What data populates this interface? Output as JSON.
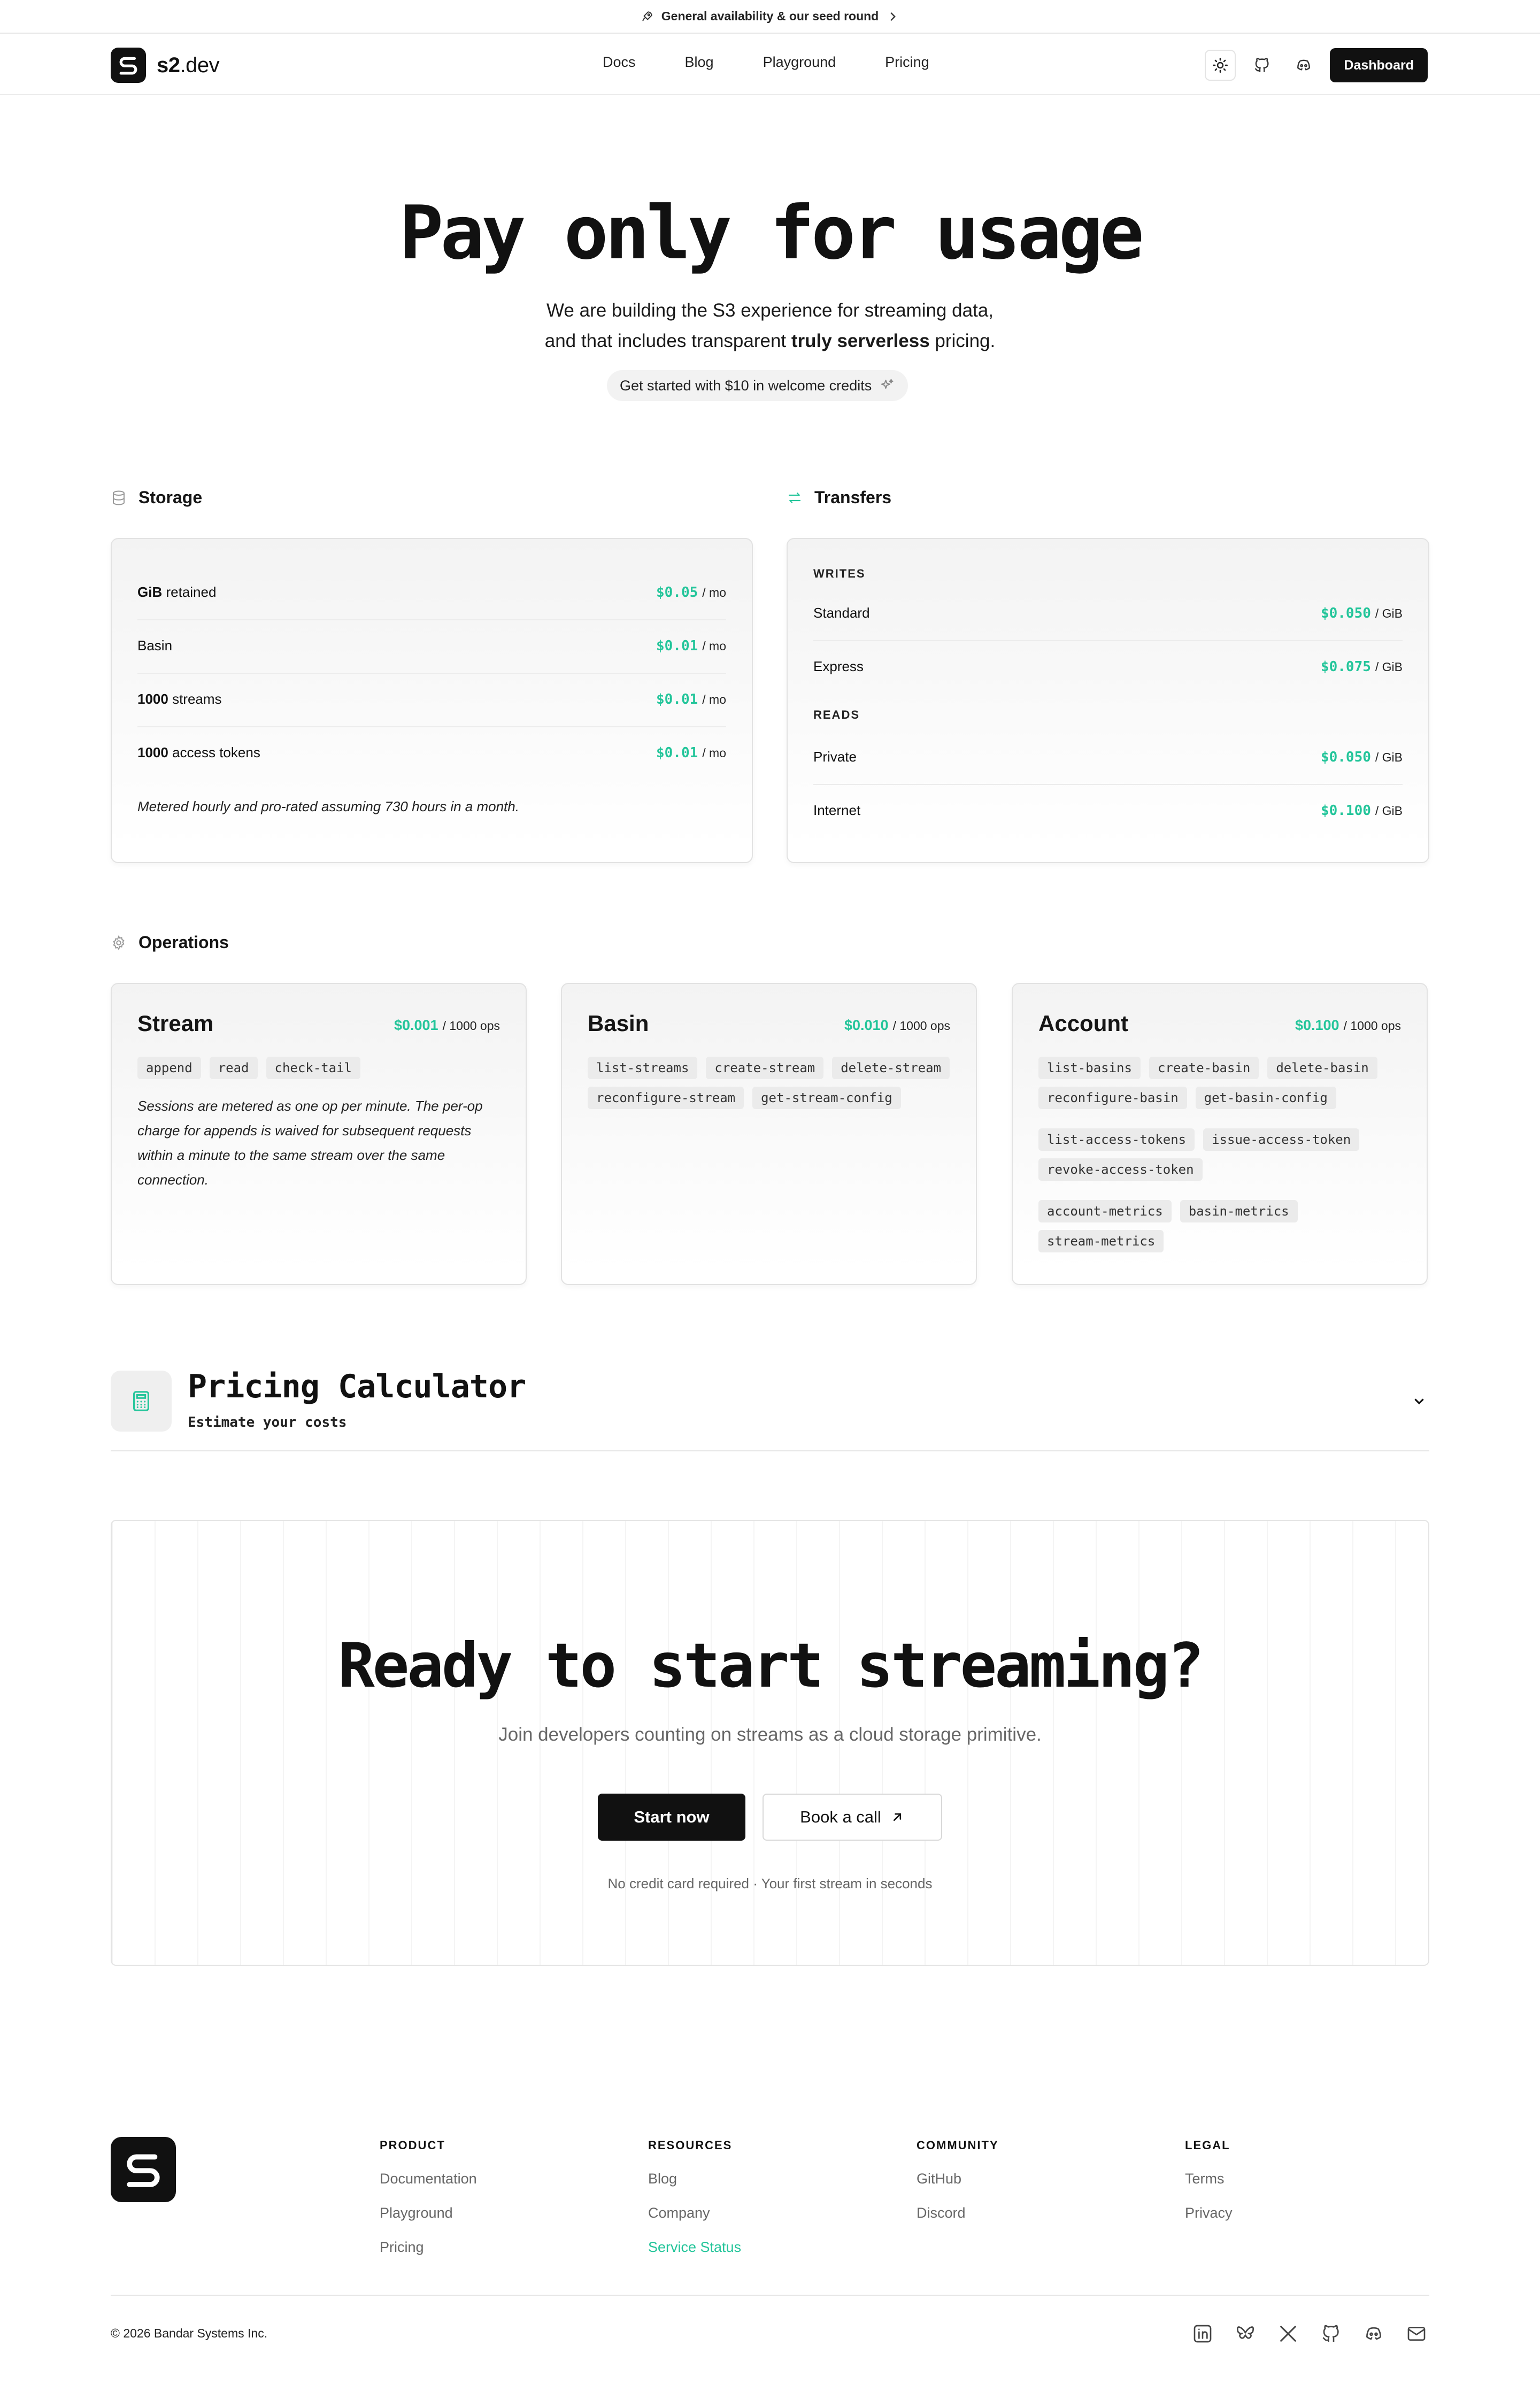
{
  "announcement": {
    "text": "General availability & our seed round"
  },
  "nav": {
    "brand_bold": "s2",
    "brand_rest": ".dev",
    "links": [
      "Docs",
      "Blog",
      "Playground",
      "Pricing"
    ],
    "dashboard_label": "Dashboard"
  },
  "hero": {
    "title": "Pay only for usage",
    "line1": "We are building the S3 experience for streaming data,",
    "line2_pre": "and that includes transparent ",
    "line2_bold": "truly serverless",
    "line2_post": " pricing.",
    "credit_pill": "Get started with $10 in welcome credits"
  },
  "storage": {
    "heading": "Storage",
    "rows": [
      {
        "bold": "GiB",
        "rest": " retained",
        "price": "$0.05",
        "unit": "/ mo"
      },
      {
        "bold": "",
        "rest": "Basin",
        "price": "$0.01",
        "unit": "/ mo"
      },
      {
        "bold": "1000",
        "rest": " streams",
        "price": "$0.01",
        "unit": "/ mo"
      },
      {
        "bold": "1000",
        "rest": " access tokens",
        "price": "$0.01",
        "unit": "/ mo"
      }
    ],
    "note": "Metered hourly and pro-rated assuming 730 hours in a month."
  },
  "transfers": {
    "heading": "Transfers",
    "writes_label": "WRITES",
    "reads_label": "READS",
    "writes": [
      {
        "label": "Standard",
        "price": "$0.050",
        "unit": "/ GiB"
      },
      {
        "label": "Express",
        "price": "$0.075",
        "unit": "/ GiB"
      }
    ],
    "reads": [
      {
        "label": "Private",
        "price": "$0.050",
        "unit": "/ GiB"
      },
      {
        "label": "Internet",
        "price": "$0.100",
        "unit": "/ GiB"
      }
    ]
  },
  "operations": {
    "heading": "Operations",
    "stream": {
      "title": "Stream",
      "price": "$0.001",
      "unit": "/ 1000 ops",
      "tags": [
        "append",
        "read",
        "check-tail"
      ],
      "note": "Sessions are metered as one op per minute. The per-op charge for appends is waived for subsequent requests within a minute to the same stream over the same connection."
    },
    "basin": {
      "title": "Basin",
      "price": "$0.010",
      "unit": "/ 1000 ops",
      "tags": [
        "list-streams",
        "create-stream",
        "delete-stream",
        "reconfigure-stream",
        "get-stream-config"
      ]
    },
    "account": {
      "title": "Account",
      "price": "$0.100",
      "unit": "/ 1000 ops",
      "tags1": [
        "list-basins",
        "create-basin",
        "delete-basin",
        "reconfigure-basin",
        "get-basin-config"
      ],
      "tags2": [
        "list-access-tokens",
        "issue-access-token",
        "revoke-access-token"
      ],
      "tags3": [
        "account-metrics",
        "basin-metrics",
        "stream-metrics"
      ]
    }
  },
  "calculator": {
    "title": "Pricing Calculator",
    "subtitle": "Estimate your costs"
  },
  "cta": {
    "title": "Ready to start streaming?",
    "subtitle": "Join developers counting on streams as a cloud storage primitive.",
    "primary": "Start now",
    "secondary": "Book a call",
    "footnote": "No credit card required · Your first stream in seconds"
  },
  "footer": {
    "columns": [
      {
        "heading": "PRODUCT",
        "links": [
          "Documentation",
          "Playground",
          "Pricing"
        ]
      },
      {
        "heading": "RESOURCES",
        "links": [
          "Blog",
          "Company",
          "Service Status"
        ]
      },
      {
        "heading": "COMMUNITY",
        "links": [
          "GitHub",
          "Discord"
        ]
      },
      {
        "heading": "LEGAL",
        "links": [
          "Terms",
          "Privacy"
        ]
      }
    ],
    "copyright": "© 2026 Bandar Systems Inc.",
    "socials": [
      "linkedin-icon",
      "bluesky-icon",
      "x-icon",
      "github-icon",
      "discord-icon",
      "mail-icon"
    ]
  },
  "colors": {
    "accent": "#23c59a",
    "text": "#111111",
    "muted": "#666666"
  }
}
